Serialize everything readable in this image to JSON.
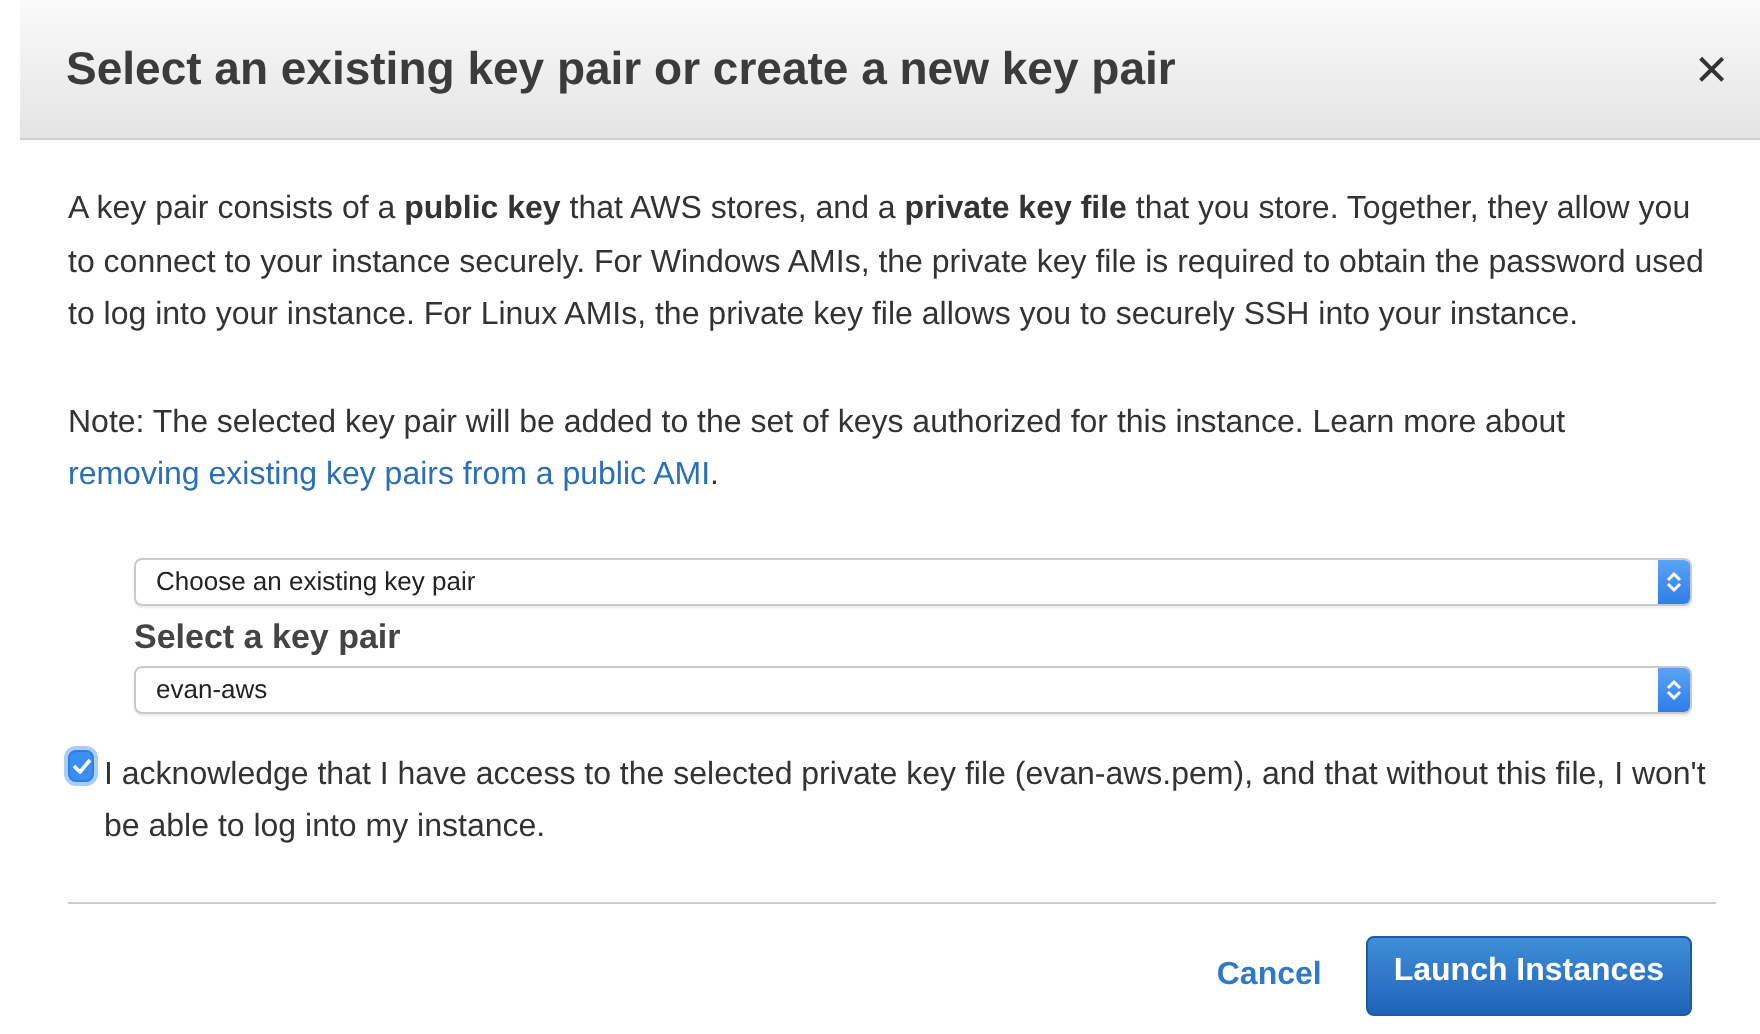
{
  "dialog": {
    "title": "Select an existing key pair or create a new key pair",
    "close": "×"
  },
  "intro": "A key pair consists of a **public key** that AWS stores, and a **private key file** that you store. Together, they allow you to connect to your instance securely. For Windows AMIs, the private key file is required to obtain the password used to log into your instance. For Linux AMIs, the private key file allows you to securely SSH into your instance.",
  "note": {
    "text": "Note: The selected key pair will be added to the set of keys authorized for this instance. Learn more about",
    "link": "removing existing key pairs from a public AMI",
    "after": "."
  },
  "mode_select": {
    "value": "Choose an existing key pair"
  },
  "key_select": {
    "label": "Select a key pair",
    "value": "evan-aws"
  },
  "acknowledge": {
    "checked": true,
    "text": "I acknowledge that I have access to the selected private key file (evan-aws.pem), and that without this file, I won't be able to log into my instance."
  },
  "buttons": [
    {
      "label": "Cancel",
      "kind": "link"
    },
    {
      "label": "Launch Instances",
      "kind": "primary"
    }
  ]
}
